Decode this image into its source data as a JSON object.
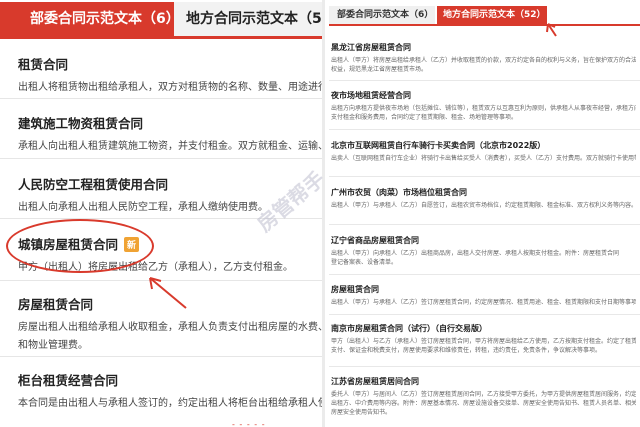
{
  "left": {
    "tabs": [
      {
        "label": "部委合同示范文本（6）",
        "active": true
      },
      {
        "label": "地方合同示范文本（52）",
        "active": false
      }
    ],
    "items": [
      {
        "title": "租赁合同",
        "badge": "",
        "desc": "出租人将租赁物出租给承租人，双方对租赁物的名称、数量、用途进行约定。",
        "desc2": ""
      },
      {
        "title": "建筑施工物资租赁合同",
        "badge": "",
        "desc": "承租人向出租人租赁建筑施工物资，并支付租金。双方就租金、运输、违约等事项进行约定。",
        "desc2": ""
      },
      {
        "title": "人民防空工程租赁使用合同",
        "badge": "",
        "desc": "出租人向承租人出租人民防空工程，承租人缴纳使用费。",
        "desc2": ""
      },
      {
        "title": "城镇房屋租赁合同",
        "badge": "新",
        "desc": "甲方（出租人）将房屋出租给乙方（承租人），乙方支付租金。",
        "desc2": ""
      },
      {
        "title": "房屋租赁合同",
        "badge": "",
        "desc": "房屋出租人出租给承租人收取租金，承租人负责支付出租房屋的水费、电费、煤气费等费用",
        "desc2": "和物业管理费。"
      },
      {
        "title": "柜台租赁经营合同",
        "badge": "",
        "desc": "本合同是由出租人与承租人签订的，约定出租人将柜台出租给承租人使用，承租人支付租金。",
        "desc2": ""
      }
    ]
  },
  "right": {
    "tabs": [
      {
        "label": "部委合同示范文本（6）",
        "active": false
      },
      {
        "label": "地方合同示范文本（52）",
        "active": true
      }
    ],
    "items": [
      {
        "title": "黑龙江省房屋租赁合同",
        "lines": [
          "出租人（甲方）将房屋出租给承租人（乙方）并收取租赁的价款，双方约定各自的权利与义务，旨在保护双方的合法",
          "权益，规范黑龙江省房屋租赁市场。"
        ]
      },
      {
        "title": "夜市场地租赁经营合同",
        "lines": [
          "出租方向承租方提供夜市场地（包括摊位、铺位等），租赁双方以互惠互利为原则，供承租人从事夜市经营，承租方向出租方",
          "支付租金和服务费用，合同约定了租赁期限、租金、场地管理等事项。"
        ]
      },
      {
        "title": "北京市互联网租赁自行车骑行卡买卖合同（北京市2022版）",
        "lines": [
          "出卖人（互联网租赁自行车企业）将骑行卡出售给买受人（消费者），买受人（乙方）支付费用。双方就骑行卡使用等事项进行约定。"
        ]
      },
      {
        "title": "广州市农贸（肉菜）市场档位租赁合同",
        "lines": [
          "出租人（甲方）与承租人（乙方）自愿签订，出租农贸市场档位，约定租赁期限、租金标准、双方权利义务等内容。"
        ]
      },
      {
        "title": "辽宁省商品房屋租赁合同",
        "lines": [
          "出租人（甲方）向承租人（乙方）出租商品房，出租人交付房屋、承租人按期支付租金。附件：房屋租赁合同",
          "登记备案表、设备清单。"
        ]
      },
      {
        "title": "房屋租赁合同",
        "lines": [
          "出租人（甲方）与承租人（乙方）签订房屋租赁合同，约定房屋情况、租赁用途、租金、租赁期限和支付日期等事项。"
        ]
      },
      {
        "title": "南京市房屋租赁合同（试行）（自行交易版）",
        "lines": [
          "甲方（出租人）与乙方（承租人）签订房屋租赁合同，甲方将房屋出租给乙方使用，乙方按期支付租金。约定了租赁期限、租金和押金的",
          "支付、保证金和税费支付，房屋使用要求和维修责任，转租，违约责任，免责条件，争议解决等事项。"
        ]
      },
      {
        "title": "江苏省房屋租赁居间合同",
        "lines": [
          "委托人（甲方）与居间人（乙方）签订房屋租赁居间合同，乙方接受甲方委托，为甲方提供房屋租赁居间服务，约定租赁房屋信息、",
          "出租方、中介费用等内容。附件：房屋基本情况、房屋设施设备交接单、房屋安全使用告知书、租赁人员名单、相关费用交接单、",
          "房屋安全使用告知书。"
        ]
      }
    ]
  },
  "watermark": "房管帮手",
  "bottom_dash": "- - - - -",
  "colors": {
    "accent": "#d83a2c",
    "badge": "#f0a334"
  }
}
